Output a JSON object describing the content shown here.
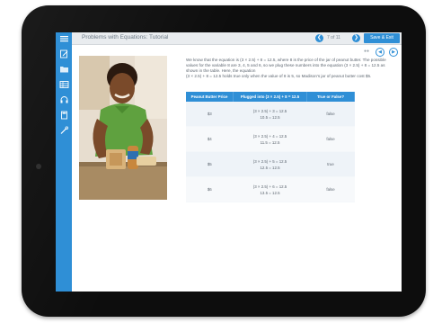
{
  "header": {
    "title": "Problems with Equations: Tutorial",
    "pager": "7 of 11",
    "save_label": "Save & Exit"
  },
  "sidebar": {
    "icons": [
      "list-icon",
      "edit-icon",
      "folder-icon",
      "table-icon",
      "headset-icon",
      "calculator-icon",
      "tools-icon"
    ]
  },
  "content": {
    "paragraph1": "We know that the equation is (3 × 2.5) + 8 = 12.5, where 8 is the price of the jar of peanut butter. The possible values for the variable 8 are 3, 4, 5 and 6, so we plug these numbers into the equation (3 × 2.5) + 8 = 12.5 as shown in the table. Here, the equation",
    "paragraph2": "(3 × 2.5) + 8 = 12.5 holds true only when the value of 8 is 5, so Madison's jar of peanut butter cost $5."
  },
  "table": {
    "headers": [
      "Peanut Butter Price",
      "Plugged into (3 × 2.5) + 8 = 12.5",
      "True or False?"
    ],
    "rows": [
      {
        "price": "$3",
        "plug1": "(3 × 2.5) + 3 = 12.5",
        "plug2": "10.5 = 12.5",
        "result": "false"
      },
      {
        "price": "$4",
        "plug1": "(3 × 2.5) + 4 = 12.5",
        "plug2": "11.5 = 12.5",
        "result": "false"
      },
      {
        "price": "$5",
        "plug1": "(3 × 2.5) + 5 = 12.5",
        "plug2": "12.5 = 12.5",
        "result": "true"
      },
      {
        "price": "$6",
        "plug1": "(3 × 2.5) + 6 = 12.5",
        "plug2": "13.5 = 12.5",
        "result": "false"
      }
    ]
  },
  "colors": {
    "accent": "#2f8fd6",
    "bezel": "#0d0d0d",
    "topbar": "#e9ecef"
  }
}
